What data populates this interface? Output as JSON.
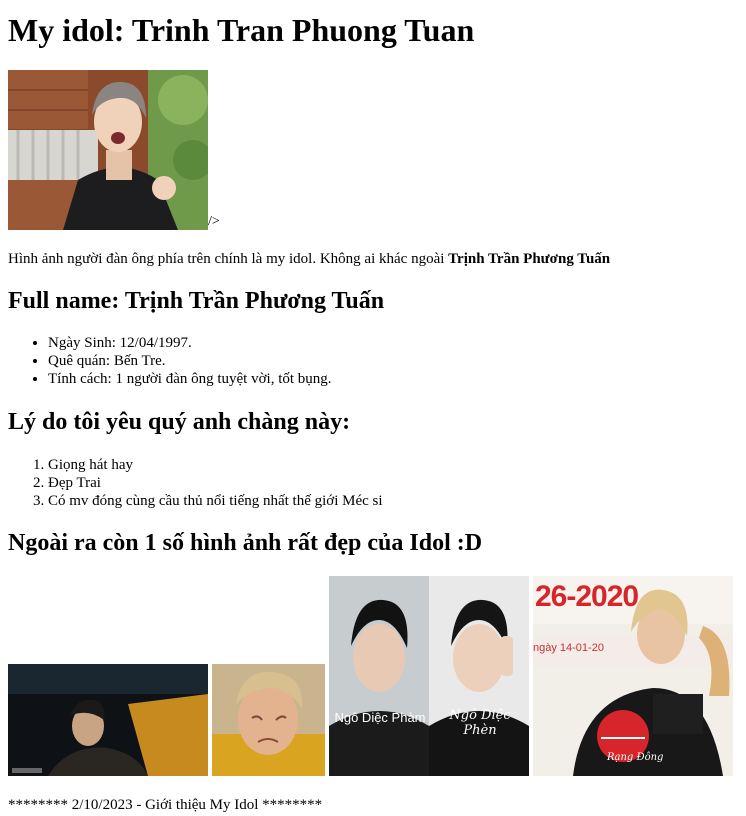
{
  "title": "My idol: Trinh Tran Phuong Tuan",
  "hero_stray_text": "/>",
  "intro": {
    "text": "Hình ảnh người đàn ông phía trên chính là my idol. Không ai khác ngoài ",
    "bold_name": "Trịnh Trần Phương Tuấn"
  },
  "full_name_heading": "Full name: Trịnh Trần Phương Tuấn",
  "info_items": [
    "Ngày Sinh: 12/04/1997.",
    "Quê quán: Bến Tre.",
    "Tính cách: 1 người đàn ông tuyệt vời, tốt bụng."
  ],
  "reasons_heading": "Lý do tôi yêu quý anh chàng này:",
  "reasons": [
    "Giọng hát hay",
    "Đẹp Trai",
    "Có mv đóng cùng cầu thủ nổi tiếng nhất thế giới Méc si"
  ],
  "gallery_heading": "Ngoài ra còn 1 số hình ảnh rất đẹp của Idol :D",
  "gallery": {
    "img3_left_caption": "Ngô Diệc Phàm",
    "img3_right_caption": "Ngô Diệc Phèn",
    "img4_banner": "26-2020",
    "img4_date": "ngày 14-01-20",
    "img4_logo": "Rạng Đông"
  },
  "footer": "******** 2/10/2023 - Giới thiệu My Idol ********",
  "colors": {
    "background": "#ffffff",
    "text": "#000000",
    "banner_red": "#d6262b"
  }
}
